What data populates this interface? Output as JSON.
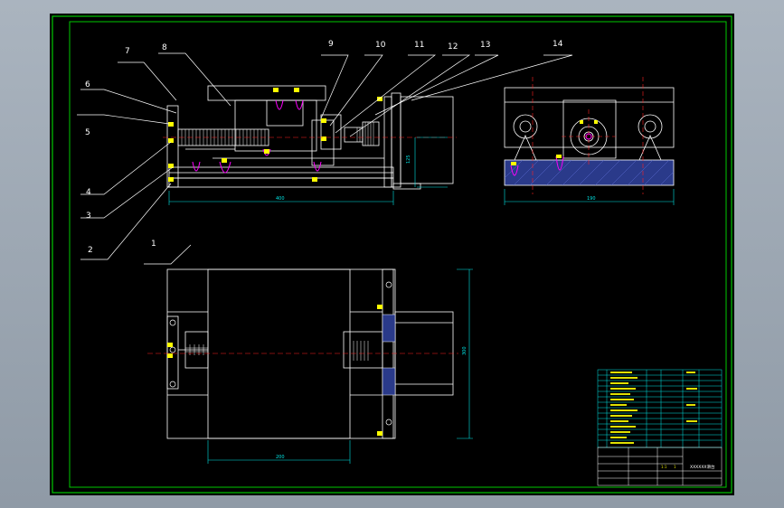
{
  "drawing": {
    "part_labels": [
      "1",
      "2",
      "3",
      "4",
      "5",
      "6",
      "7",
      "8",
      "9",
      "10",
      "11",
      "12",
      "13",
      "14"
    ],
    "dimensions": {
      "front_length": "400",
      "front_height": "125",
      "side_width": "190",
      "top_travel": "200",
      "top_height": "300"
    },
    "title_block": {
      "drawing_name": "XXXXXX滑台",
      "scale": "1:1",
      "sheet": "1"
    }
  },
  "colors": {
    "background": "#000000",
    "frame": "#00c800",
    "outline": "#ffffff",
    "dimension": "#00e5e5",
    "centerline": "#ff2020",
    "highlight": "#ff00ff",
    "fastener": "#ffff00",
    "hatch": "#2a3a8a"
  }
}
